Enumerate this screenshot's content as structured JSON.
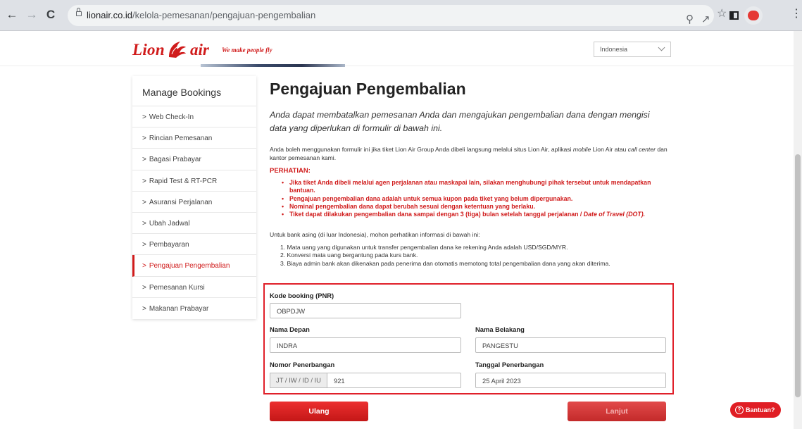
{
  "browser": {
    "url_host": "lionair.co.id",
    "url_path": "/kelola-pemesanan/pengajuan-pengembalian"
  },
  "header": {
    "logo_left": "Lion",
    "logo_right": "air",
    "tagline": "We make people fly",
    "country": "Indonesia"
  },
  "sidebar": {
    "title": "Manage Bookings",
    "items": [
      {
        "label": "Web Check-In"
      },
      {
        "label": "Rincian Pemesanan"
      },
      {
        "label": "Bagasi Prabayar"
      },
      {
        "label": "Rapid Test & RT-PCR"
      },
      {
        "label": "Asuransi Perjalanan"
      },
      {
        "label": "Ubah Jadwal"
      },
      {
        "label": "Pembayaran"
      },
      {
        "label": "Pengajuan Pengembalian"
      },
      {
        "label": "Pemesanan Kursi"
      },
      {
        "label": "Makanan Prabayar"
      }
    ],
    "active_index": 7
  },
  "main": {
    "title": "Pengajuan Pengembalian",
    "lead": "Anda dapat membatalkan pemesanan Anda dan mengajukan pengembalian dana dengan mengisi data yang diperlukan di formulir di bawah ini.",
    "info_part1": "Anda boleh menggunakan formulir ini jika tiket Lion Air Group Anda dibeli langsung melalui situs Lion Air, aplikasi ",
    "info_mobile": "mobile",
    "info_part2": " Lion Air atau ",
    "info_callcenter": "call center",
    "info_part3": " dan kantor pemesanan kami.",
    "warning_title": "PERHATIAN:",
    "warnings": [
      "Jika tiket Anda dibeli melalui agen perjalanan atau maskapai lain, silakan menghubungi pihak tersebut untuk mendapatkan bantuan.",
      "Pengajuan pengembalian dana adalah untuk semua kupon pada tiket yang belum dipergunakan.",
      "Nominal pengembalian dana dapat berubah sesuai dengan ketentuan yang berlaku."
    ],
    "warning_last": "Tiket dapat dilakukan pengembalian dana sampai dengan 3 (tiga) bulan setelah tanggal perjalanan / ",
    "warning_last_italic": "Date of Travel (DOT).",
    "bank_intro": "Untuk bank asing (di luar Indonesia), mohon perhatikan informasi di bawah ini:",
    "bank_notes": [
      "1. Mata uang yang digunakan untuk transfer pengembalian dana ke rekening Anda adalah USD/SGD/MYR.",
      "2. Konversi mata uang bergantung pada kurs bank.",
      "3. Biaya admin bank akan dikenakan pada penerima dan otomatis memotong total pengembalian dana yang akan diterima."
    ]
  },
  "form": {
    "pnr_label": "Kode booking (PNR)",
    "pnr_value": "OBPDJW",
    "first_name_label": "Nama Depan",
    "first_name_value": "INDRA",
    "last_name_label": "Nama Belakang",
    "last_name_value": "PANGESTU",
    "flight_number_label": "Nomor Penerbangan",
    "flight_prefix": "JT / IW / ID / IU",
    "flight_number_value": "921",
    "flight_date_label": "Tanggal Penerbangan",
    "flight_date_value": "25 April 2023"
  },
  "buttons": {
    "reset": "Ulang",
    "next": "Lanjut",
    "help": "Bantuan?"
  },
  "colors": {
    "brand_red": "#d01b1b",
    "highlight_border": "#e0202a"
  }
}
